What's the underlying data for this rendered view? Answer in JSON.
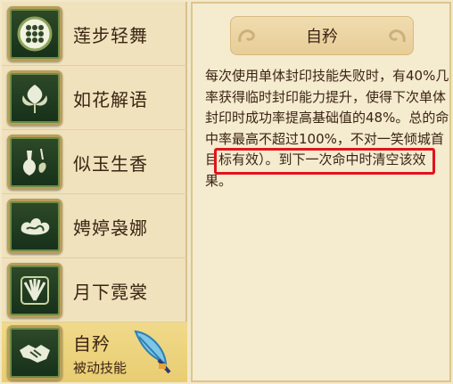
{
  "skills": [
    {
      "name": "莲步轻舞",
      "icon": "lotus-grid-icon",
      "selected": false
    },
    {
      "name": "如花解语",
      "icon": "flower-icon",
      "selected": false
    },
    {
      "name": "似玉生香",
      "icon": "vase-icon",
      "selected": false
    },
    {
      "name": "娉婷袅娜",
      "icon": "cloud-icon",
      "selected": false
    },
    {
      "name": "月下霓裳",
      "icon": "fan-icon",
      "selected": false
    },
    {
      "name": "自矜",
      "subtitle": "被动技能",
      "icon": "handshake-icon",
      "selected": true
    }
  ],
  "detail": {
    "title": "自矜",
    "description_part1": "每次使用单体封印技能失败时，有40%几率获得临时封印能力提升，使得下次单体封印时成功率提高基础值的48%。",
    "description_highlight": "总的命中率最高不超过100",
    "description_part2": "%，不对一笑倾城首目标有效）。到下一次命中时清空该效果。"
  },
  "colors": {
    "highlight_border": "#e0141c",
    "selected_row": "#e8cd72",
    "text": "#3a2414"
  }
}
